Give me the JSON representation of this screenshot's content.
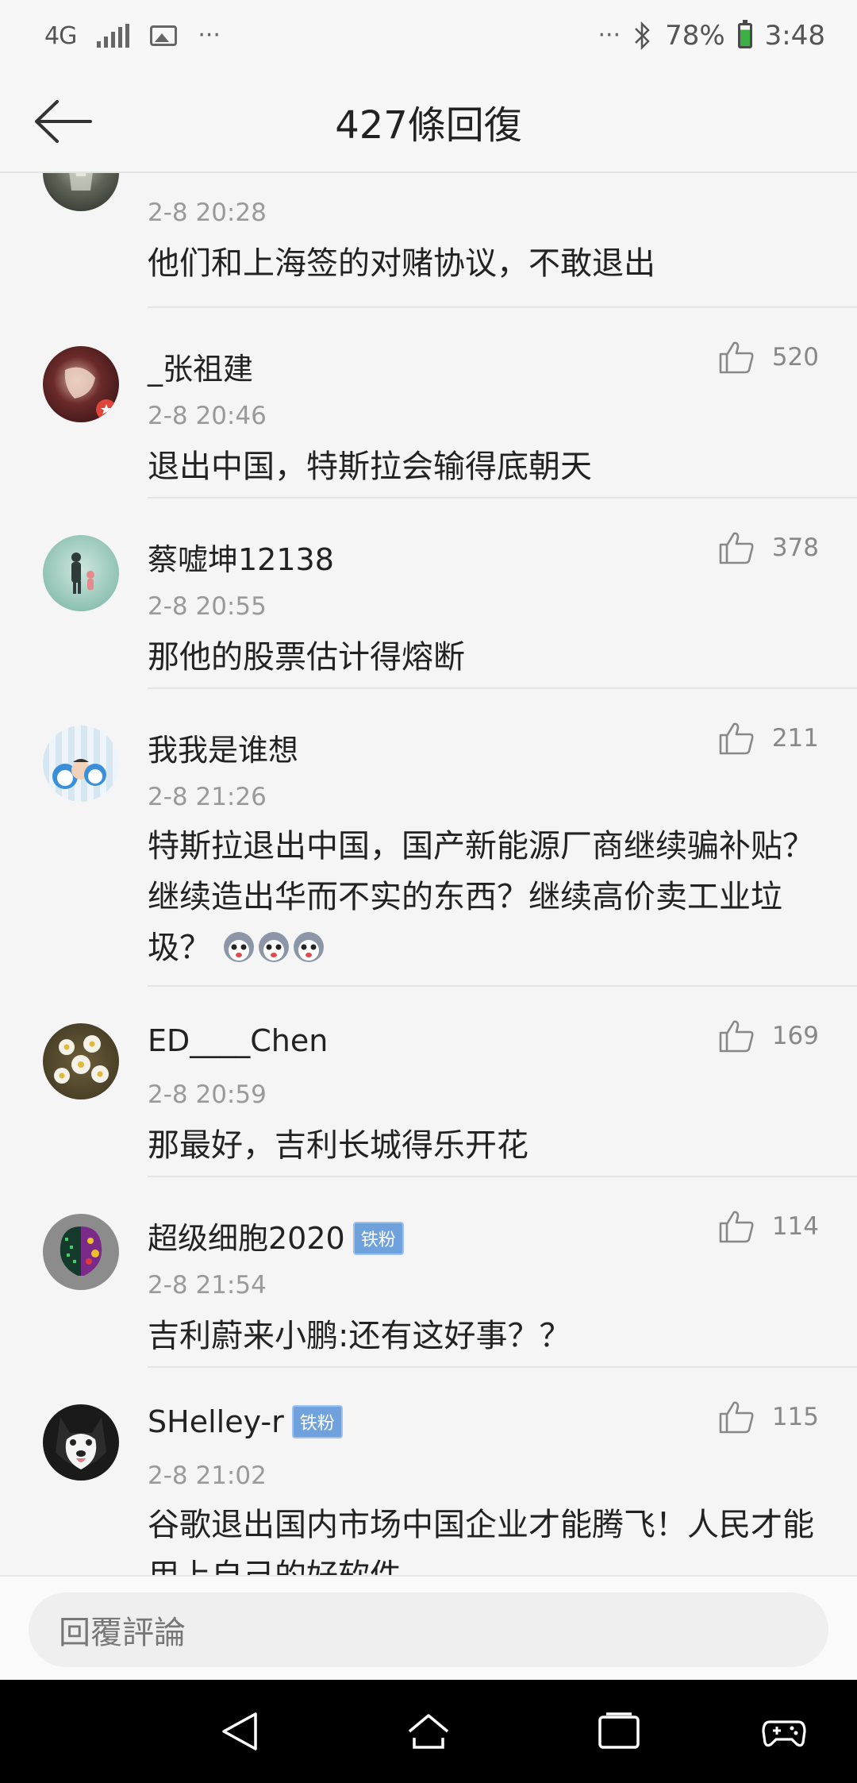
{
  "status_bar": {
    "network": "4G",
    "network_sub": "G",
    "dots_left": "···",
    "dots_right": "···",
    "battery": "78%",
    "time": "3:48",
    "icons": [
      "signal-icon",
      "image-icon",
      "bluetooth-icon",
      "battery-icon"
    ]
  },
  "header": {
    "title": "427條回復",
    "back_icon": "back-arrow-icon"
  },
  "comments": [
    {
      "name": "",
      "time": "2-8 20:28",
      "text": "他们和上海签的对赌协议，不敢退出",
      "likes": ""
    },
    {
      "name": "_张祖建",
      "time": "2-8 20:46",
      "text": "退出中国，特斯拉会输得底朝天",
      "likes": "520"
    },
    {
      "name": "蔡嘘坤12138",
      "time": "2-8 20:55",
      "text": "那他的股票估计得熔断",
      "likes": "378"
    },
    {
      "name": "我我是谁想",
      "time": "2-8 21:26",
      "text": "特斯拉退出中国，国产新能源厂商继续骗补贴？继续造出华而不实的东西？继续高价卖工业垃圾？",
      "likes": "211"
    },
    {
      "name": "ED____Chen",
      "time": "2-8 20:59",
      "text": "那最好，吉利长城得乐开花",
      "likes": "169"
    },
    {
      "name": "超级细胞2020",
      "badge": "铁粉",
      "time": "2-8 21:54",
      "text": "吉利蔚来小鹏:还有这好事？？",
      "likes": "114"
    },
    {
      "name": "SHelley-r",
      "badge": "铁粉",
      "time": "2-8 21:02",
      "text": "谷歌退出国内市场中国企业才能腾飞！人民才能用上自己的好软件",
      "likes": "115"
    }
  ],
  "reply_bar": {
    "placeholder": "回覆評論"
  },
  "nav_bar": {
    "icons": [
      "nav-back-icon",
      "nav-home-icon",
      "nav-recents-icon",
      "game-controller-icon"
    ]
  },
  "colors": {
    "background": "#f5f5f5",
    "badge": "#6fa1dc",
    "battery_fill": "#3cb043"
  }
}
